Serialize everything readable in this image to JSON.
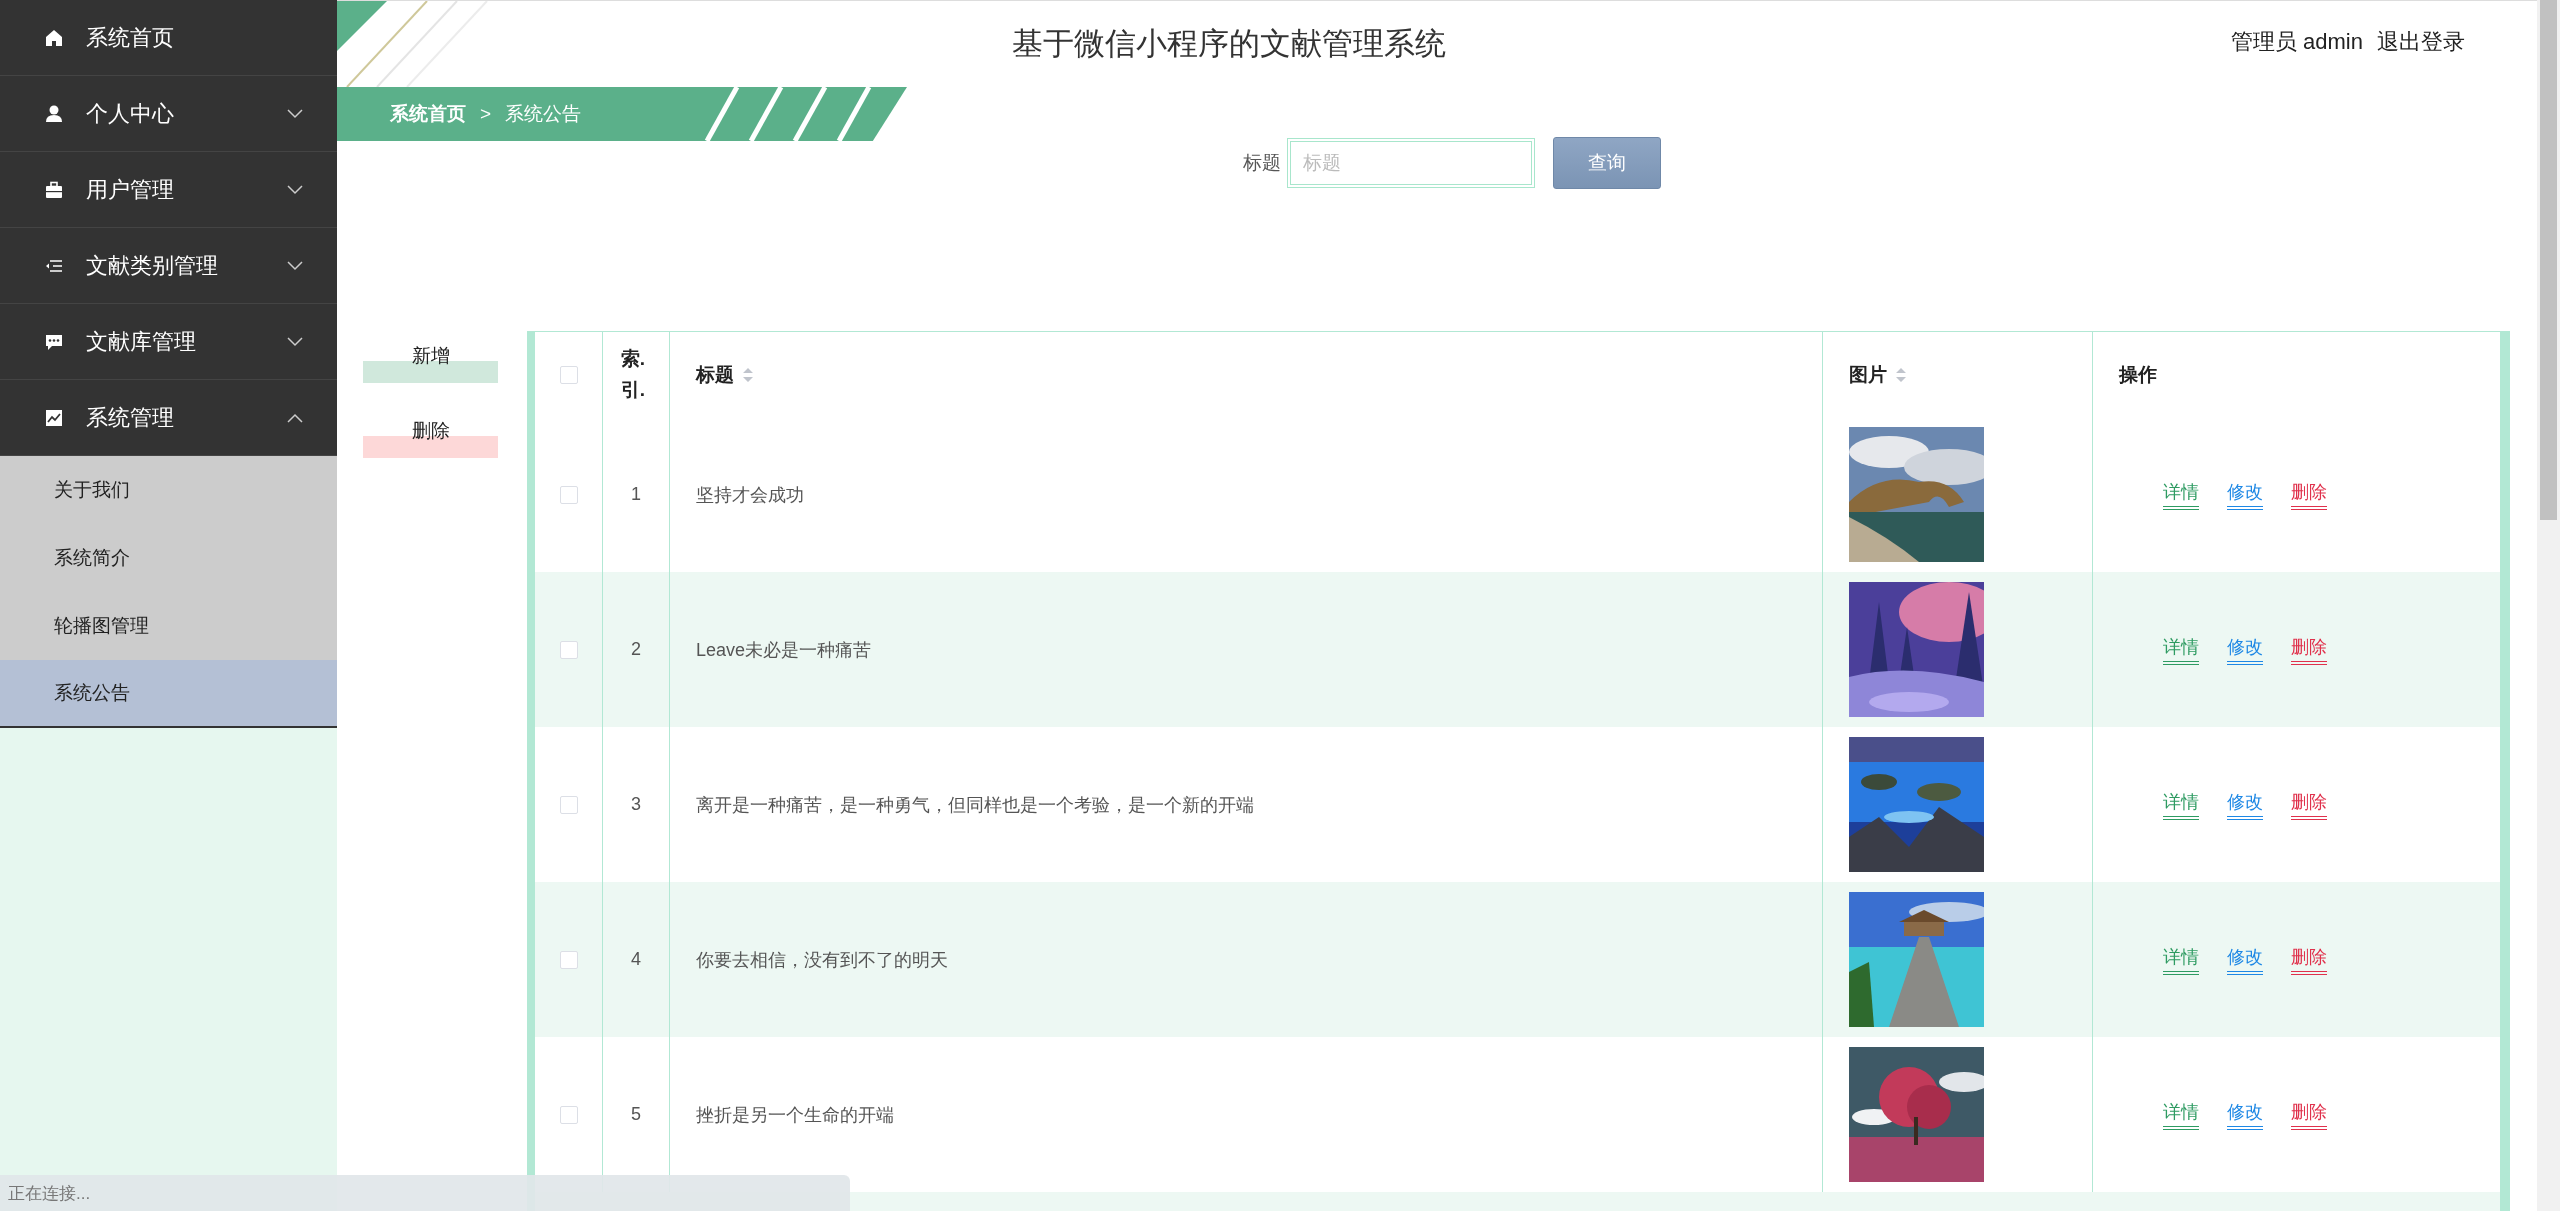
{
  "sidebar": {
    "items": [
      {
        "label": "系统首页"
      },
      {
        "label": "个人中心",
        "expanded": false
      },
      {
        "label": "用户管理",
        "expanded": false
      },
      {
        "label": "文献类别管理",
        "expanded": false
      },
      {
        "label": "文献库管理",
        "expanded": false
      },
      {
        "label": "系统管理",
        "expanded": true,
        "children": [
          {
            "label": "关于我们",
            "selected": false
          },
          {
            "label": "系统简介",
            "selected": false
          },
          {
            "label": "轮播图管理",
            "selected": false
          },
          {
            "label": "系统公告",
            "selected": true
          }
        ]
      }
    ]
  },
  "header": {
    "title": "基于微信小程序的文献管理系统",
    "user": "管理员 admin",
    "logout": "退出登录"
  },
  "breadcrumb": {
    "items": [
      "系统首页",
      "系统公告"
    ],
    "separator": ">"
  },
  "search": {
    "label": "标题",
    "placeholder": "标题",
    "button": "查询"
  },
  "actions": [
    {
      "kind": "add",
      "label": "新增"
    },
    {
      "kind": "delete",
      "label": "删除"
    }
  ],
  "table": {
    "columns": [
      {
        "kind": "checkbox",
        "checked": false
      },
      {
        "kind": "index",
        "label": "索.引."
      },
      {
        "kind": "text",
        "label": "标题",
        "sortable": true
      },
      {
        "kind": "picture",
        "label": "图片",
        "sortable": true
      },
      {
        "kind": "actions",
        "label": "操作"
      }
    ],
    "rows": [
      {
        "checked": false,
        "index": "1",
        "title": "坚持才会成功",
        "actions": [
          {
            "kind": "detail",
            "label": "详情"
          },
          {
            "kind": "edit",
            "label": "修改"
          },
          {
            "kind": "delete",
            "label": "删除"
          }
        ]
      },
      {
        "checked": false,
        "index": "2",
        "title": "Leave未必是一种痛苦",
        "actions": [
          {
            "kind": "detail",
            "label": "详情"
          },
          {
            "kind": "edit",
            "label": "修改"
          },
          {
            "kind": "delete",
            "label": "删除"
          }
        ]
      },
      {
        "checked": false,
        "index": "3",
        "title": "离开是一种痛苦，是一种勇气，但同样也是一个考验，是一个新的开端",
        "actions": [
          {
            "kind": "detail",
            "label": "详情"
          },
          {
            "kind": "edit",
            "label": "修改"
          },
          {
            "kind": "delete",
            "label": "删除"
          }
        ]
      },
      {
        "checked": false,
        "index": "4",
        "title": "你要去相信，没有到不了的明天",
        "actions": [
          {
            "kind": "detail",
            "label": "详情"
          },
          {
            "kind": "edit",
            "label": "修改"
          },
          {
            "kind": "delete",
            "label": "删除"
          }
        ]
      },
      {
        "checked": false,
        "index": "5",
        "title": "挫折是另一个生命的开端",
        "actions": [
          {
            "kind": "detail",
            "label": "详情"
          },
          {
            "kind": "edit",
            "label": "修改"
          },
          {
            "kind": "delete",
            "label": "删除"
          }
        ]
      }
    ]
  },
  "status_bar": {
    "text": "正在连接..."
  }
}
